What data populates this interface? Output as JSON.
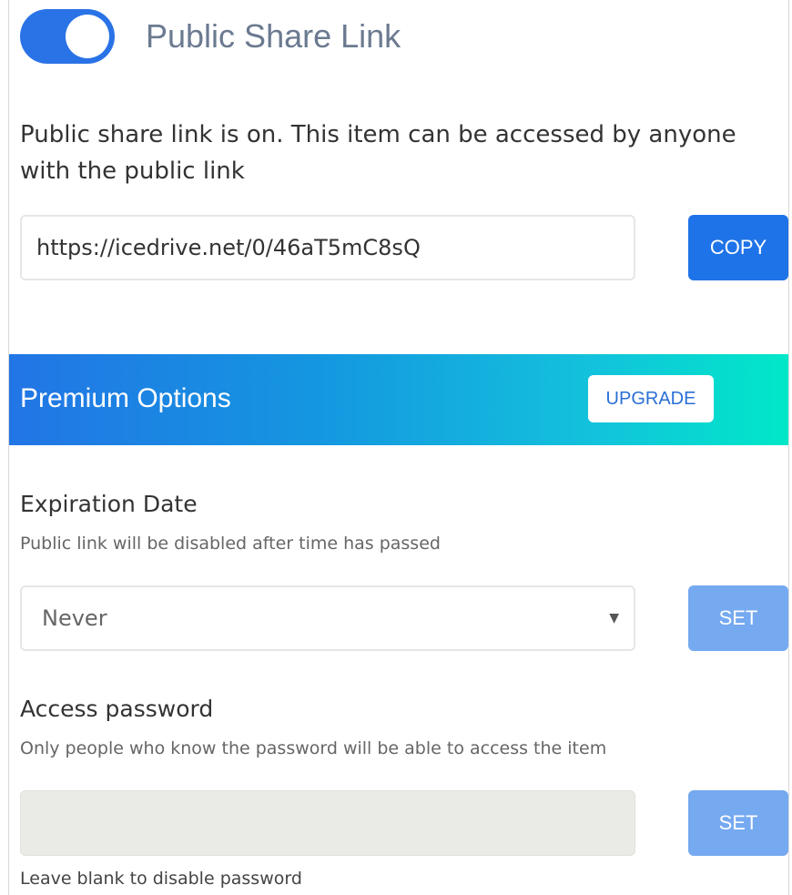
{
  "header": {
    "toggle_state": "on",
    "title": "Public Share Link"
  },
  "share": {
    "description": "Public share link is on. This item can be accessed by anyone with the public link",
    "link_value": "https://icedrive.net/0/46aT5mC8sQ",
    "copy_label": "COPY"
  },
  "premium": {
    "title": "Premium Options",
    "upgrade_label": "UPGRADE"
  },
  "expiration": {
    "title": "Expiration Date",
    "subtitle": "Public link will be disabled after time has passed",
    "selected": "Never",
    "set_label": "SET"
  },
  "password": {
    "title": "Access password",
    "subtitle": "Only people who know the password will be able to access the item",
    "value": "",
    "set_label": "SET",
    "helper": "Leave blank to disable password"
  },
  "colors": {
    "accent": "#1f73e8",
    "set_disabled": "#75a9f0",
    "banner_start": "#2275e5",
    "banner_end": "#00e8c8"
  }
}
